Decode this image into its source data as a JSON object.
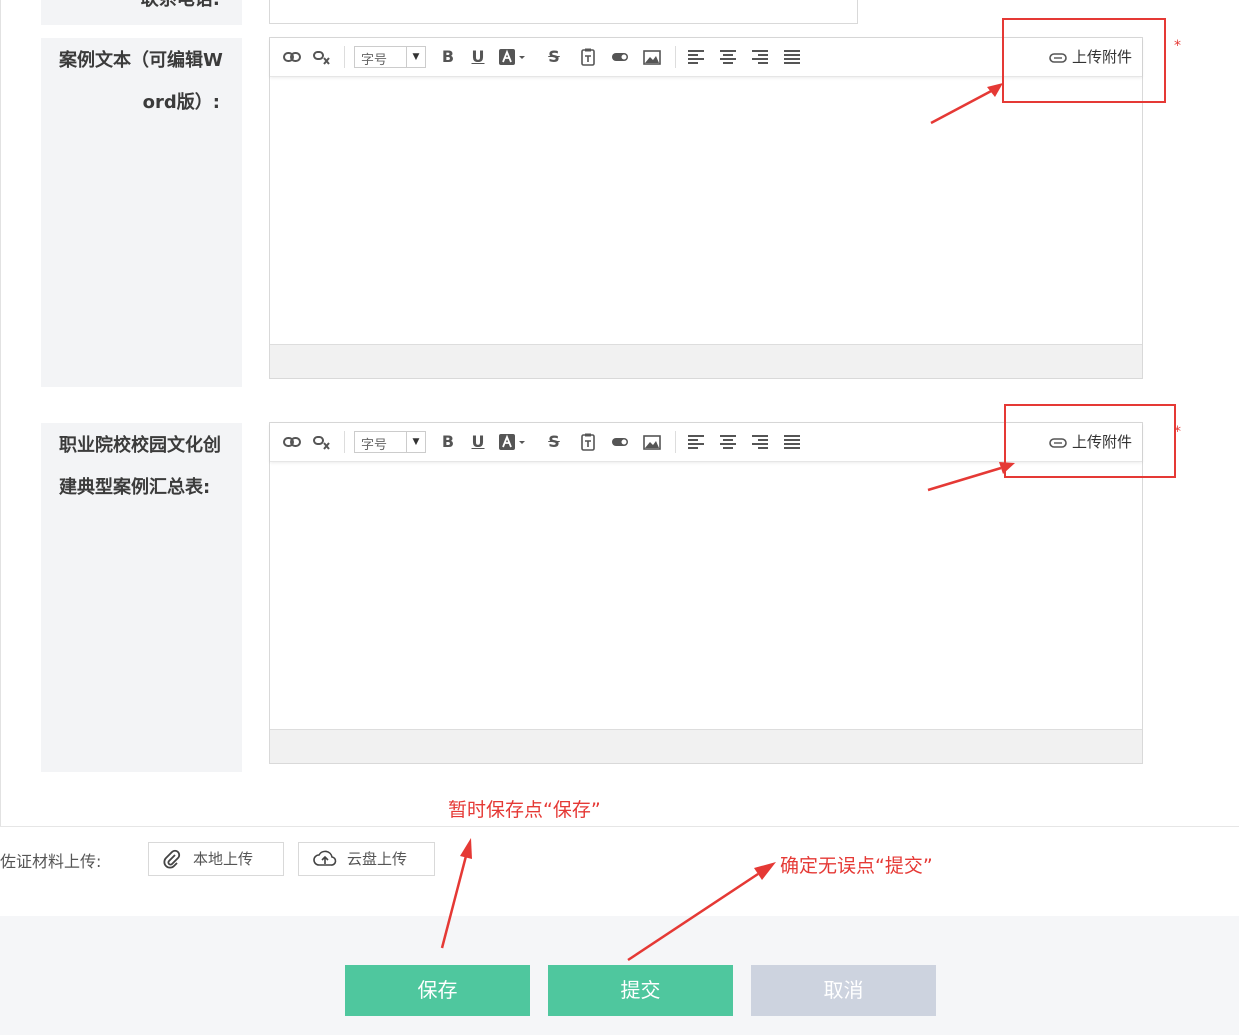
{
  "contact_phone": {
    "label": "联系电话:"
  },
  "case_text": {
    "label_line1": "案例文本（可编辑W",
    "label_line2": "ord版）:",
    "upload_attach": "上传附件",
    "required_mark": "*"
  },
  "summary_table": {
    "label_line1": "职业院校校园文化创",
    "label_line2": "建典型案例汇总表:",
    "upload_attach": "上传附件",
    "required_mark": "*"
  },
  "toolbar": {
    "font_size_label": "字号",
    "bold": "B",
    "underline": "U",
    "strike": "S",
    "icons": [
      "link-icon",
      "unlink-icon",
      "font-size-select",
      "bold-icon",
      "underline-icon",
      "font-color-icon",
      "strikethrough-icon",
      "paste-text-icon",
      "toggle-icon",
      "image-icon",
      "align-left-icon",
      "align-center-icon",
      "align-right-icon",
      "align-justify-icon"
    ]
  },
  "evidence": {
    "label": "佐证材料上传:",
    "local_upload": "本地上传",
    "cloud_upload": "云盘上传"
  },
  "annotations": {
    "save_hint": "暂时保存点“保存”",
    "submit_hint": "确定无误点“提交”"
  },
  "actions": {
    "save": "保存",
    "submit": "提交",
    "cancel": "取消"
  },
  "colors": {
    "primary_button": "#4fc79e",
    "cancel_button": "#cdd3df",
    "annotation_red": "#e53935"
  }
}
